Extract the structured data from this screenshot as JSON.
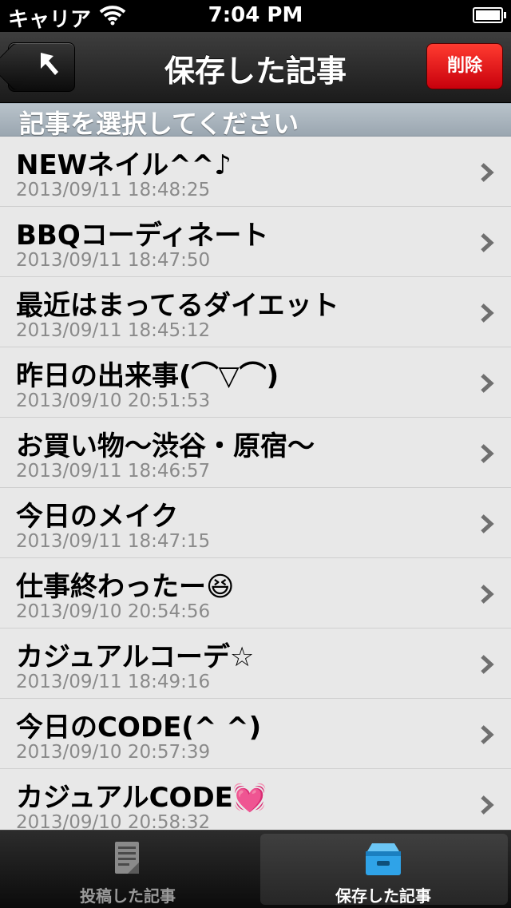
{
  "status_bar": {
    "carrier": "キャリア",
    "time": "7:04 PM"
  },
  "nav_bar": {
    "title": "保存した記事",
    "delete_label": "削除"
  },
  "section_header": "記事を選択してください",
  "articles": [
    {
      "title": "NEWネイル^^♪",
      "date": "2013/09/11 18:48:25"
    },
    {
      "title": "BBQコーディネート",
      "date": "2013/09/11 18:47:50"
    },
    {
      "title": "最近はまってるダイエット",
      "date": "2013/09/11 18:45:12"
    },
    {
      "title": "昨日の出来事(⌒▽⌒)",
      "date": "2013/09/10 20:51:53"
    },
    {
      "title": "お買い物〜渋谷・原宿〜",
      "date": "2013/09/11 18:46:57"
    },
    {
      "title": "今日のメイク",
      "date": "2013/09/11 18:47:15"
    },
    {
      "title": "仕事終わったー😆",
      "date": "2013/09/10 20:54:56"
    },
    {
      "title": "カジュアルコーデ☆",
      "date": "2013/09/11 18:49:16"
    },
    {
      "title": "今日のCODE(^ ^)",
      "date": "2013/09/10 20:57:39"
    },
    {
      "title": "カジュアルCODE💓",
      "date": "2013/09/10 20:58:32"
    }
  ],
  "tab_bar": {
    "tabs": [
      {
        "label": "投稿した記事",
        "icon": "document-icon",
        "selected": false
      },
      {
        "label": "保存した記事",
        "icon": "file-box-icon",
        "selected": true
      }
    ]
  },
  "colors": {
    "delete_button": "#e8000e",
    "section_header": "#a5b0ba",
    "date_text": "#8a8a8a",
    "selected_tab_icon": "#2fa3e8"
  }
}
